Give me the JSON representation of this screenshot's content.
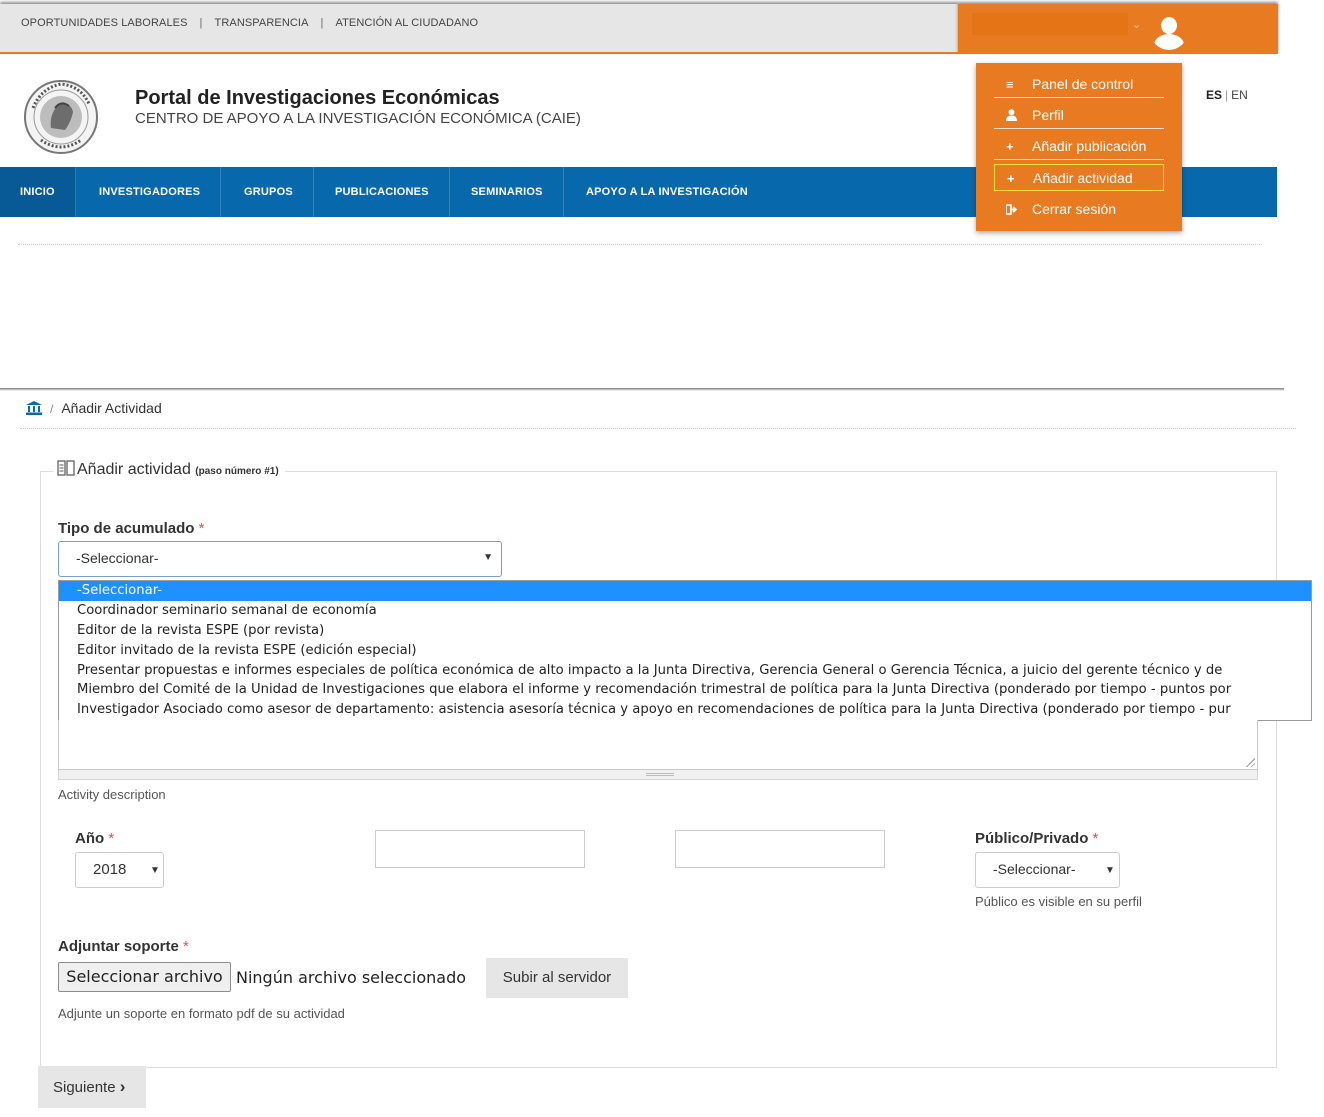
{
  "header": {
    "utility_links": [
      "OPORTUNIDADES LABORALES",
      "TRANSPARENCIA",
      "ATENCIÓN AL CIUDADANO"
    ],
    "separator": "|",
    "portal_title": "Portal de Investigaciones Económicas",
    "portal_subtitle": "CENTRO DE APOYO A LA INVESTIGACIÓN ECONÓMICA (CAIE)",
    "lang_es": "ES",
    "lang_sep": "|",
    "lang_en": "EN",
    "user_chevron": "⌄"
  },
  "nav": {
    "items": [
      "INICIO",
      "INVESTIGADORES",
      "GRUPOS",
      "PUBLICACIONES",
      "SEMINARIOS",
      "APOYO A LA INVESTIGACIÓN"
    ]
  },
  "user_menu": {
    "items": [
      {
        "label": "Panel de control",
        "icon": "list-icon"
      },
      {
        "label": "Perfil",
        "icon": "user-icon"
      },
      {
        "label": "Añadir publicación",
        "icon": "plus-icon"
      },
      {
        "label": "Añadir actividad",
        "icon": "plus-icon"
      },
      {
        "label": "Cerrar sesión",
        "icon": "sign-out-icon"
      }
    ]
  },
  "breadcrumb": {
    "separator": "/",
    "current": "Añadir Actividad"
  },
  "form": {
    "legend_title": "Añadir actividad",
    "legend_step": "(paso número #1)",
    "required_mark": "*",
    "tipo_label": "Tipo de acumulado",
    "tipo_selected": "-Seleccionar-",
    "tipo_options": [
      "-Seleccionar-",
      "Coordinador seminario semanal de economía",
      "Editor de la revista ESPE (por revista)",
      "Editor invitado de la revista ESPE (edición especial)",
      "Presentar propuestas e informes especiales de política económica de alto impacto a la Junta Directiva, Gerencia General o Gerencia Técnica, a juicio del gerente técnico y de",
      "Miembro del Comité de la Unidad de Investigaciones que elabora el informe y recomendación trimestral de política para la Junta Directiva (ponderado por tiempo - puntos por",
      "Investigador Asociado como asesor de departamento: asistencia asesoría técnica y apoyo en recomendaciones de política para la Junta Directiva (ponderado por tiempo - pur"
    ],
    "description_help": "Activity description",
    "anio_label": "Año",
    "anio_value": "2018",
    "publico_label": "Público/Privado",
    "publico_value": "-Seleccionar-",
    "publico_help": "Público es visible en su perfil",
    "soporte_label": "Adjuntar soporte",
    "file_button": "Seleccionar archivo",
    "file_status": "Ningún archivo seleccionado",
    "upload_button": "Subir al servidor",
    "soporte_help": "Adjunte un soporte en formato pdf de su actividad",
    "next_button": "Siguiente",
    "next_chevron": "›"
  },
  "colors": {
    "accent_orange": "#e87a22",
    "nav_blue": "#0868ac",
    "selected_option": "#1e90ff",
    "menu_highlight_border": "#fce23d"
  }
}
